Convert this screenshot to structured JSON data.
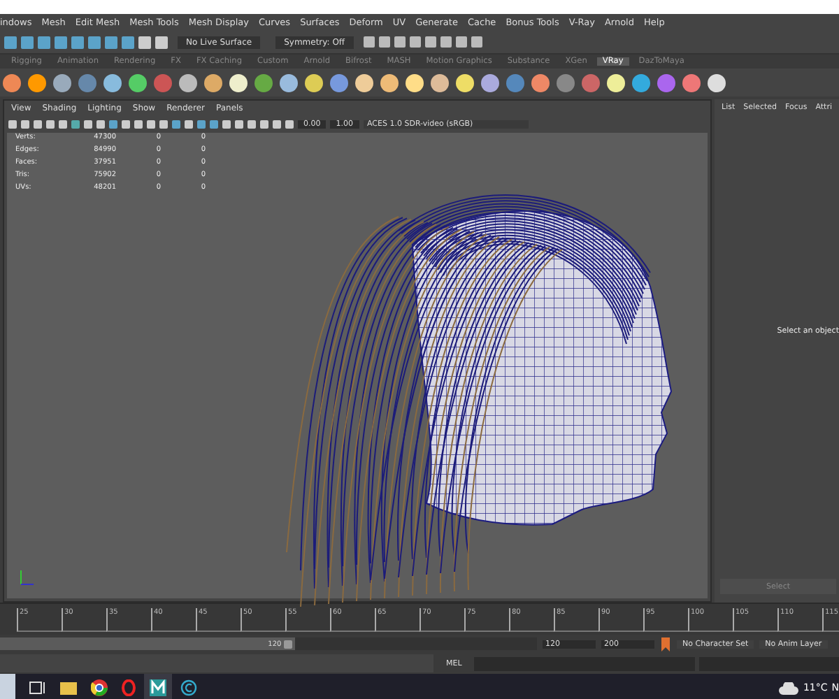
{
  "menu_bar": [
    "indows",
    "Mesh",
    "Edit Mesh",
    "Mesh Tools",
    "Mesh Display",
    "Curves",
    "Surfaces",
    "Deform",
    "UV",
    "Generate",
    "Cache",
    "Bonus Tools",
    "V-Ray",
    "Arnold",
    "Help"
  ],
  "status_line": {
    "live_surface": "No Live Surface",
    "symmetry": "Symmetry: Off"
  },
  "shelf_tabs": [
    {
      "label": "Rigging",
      "selected": false
    },
    {
      "label": "Animation",
      "selected": false
    },
    {
      "label": "Rendering",
      "selected": false
    },
    {
      "label": "FX",
      "selected": false
    },
    {
      "label": "FX Caching",
      "selected": false
    },
    {
      "label": "Custom",
      "selected": false
    },
    {
      "label": "Arnold",
      "selected": false
    },
    {
      "label": "Bifrost",
      "selected": false
    },
    {
      "label": "MASH",
      "selected": false
    },
    {
      "label": "Motion Graphics",
      "selected": false
    },
    {
      "label": "Substance",
      "selected": false
    },
    {
      "label": "XGen",
      "selected": false
    },
    {
      "label": "VRay",
      "selected": true
    },
    {
      "label": "DazToMaya",
      "selected": false
    }
  ],
  "viewport": {
    "menu": [
      "View",
      "Shading",
      "Lighting",
      "Show",
      "Renderer",
      "Panels"
    ],
    "exposure": "0.00",
    "gamma": "1.00",
    "color_space": "ACES 1.0 SDR-video (sRGB)",
    "hud": [
      {
        "label": "Verts:",
        "values": [
          "47300",
          "0",
          "0"
        ]
      },
      {
        "label": "Edges:",
        "values": [
          "84990",
          "0",
          "0"
        ]
      },
      {
        "label": "Faces:",
        "values": [
          "37951",
          "0",
          "0"
        ]
      },
      {
        "label": "Tris:",
        "values": [
          "75902",
          "0",
          "0"
        ]
      },
      {
        "label": "UVs:",
        "values": [
          "48201",
          "0",
          "0"
        ]
      }
    ]
  },
  "attribute_panel": {
    "tabs": [
      "List",
      "Selected",
      "Focus",
      "Attri"
    ],
    "message": "Select an object",
    "button": "Select"
  },
  "time_slider": {
    "ticks": [
      "25",
      "30",
      "35",
      "40",
      "45",
      "50",
      "55",
      "60",
      "65",
      "70",
      "75",
      "80",
      "85",
      "90",
      "95",
      "100",
      "105",
      "110",
      "115"
    ]
  },
  "range_slider": {
    "level": 0.55,
    "range_end": "120",
    "end_time": "120",
    "anim_end": "200",
    "character_set": "No Character Set",
    "anim_layer": "No Anim Layer"
  },
  "command_line": {
    "label": "MEL"
  },
  "taskbar": {
    "weather": "11°C",
    "cut_text": "N"
  }
}
